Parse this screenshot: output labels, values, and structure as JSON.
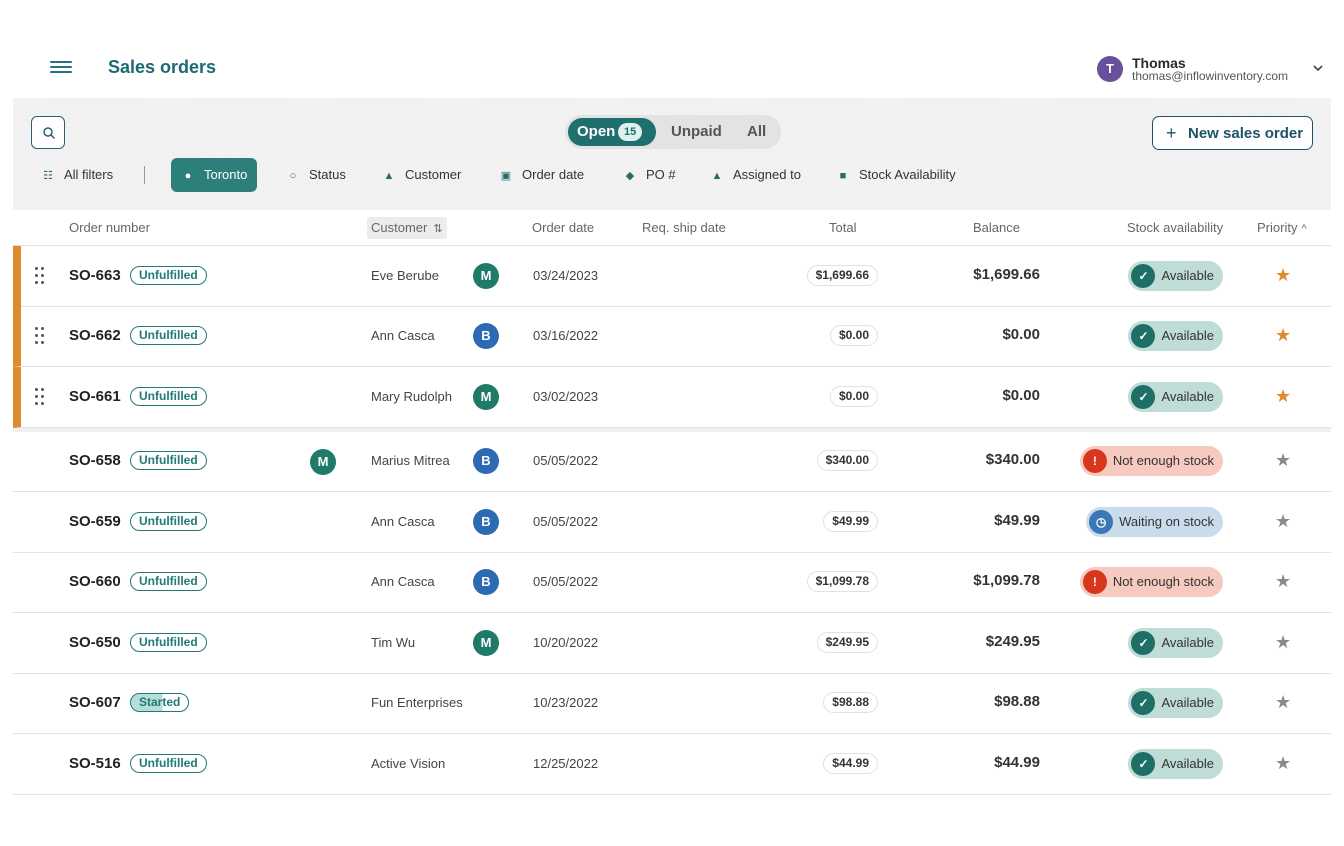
{
  "header": {
    "title": "Sales orders",
    "menu_icon": "hamburger-icon",
    "user": {
      "initial": "T",
      "name": "Thomas",
      "email": "thomas@inflowinventory.com",
      "avatar_color": "#6a4f9a"
    }
  },
  "toolbar": {
    "tabs": [
      {
        "label": "Open",
        "count": "15",
        "selected": true
      },
      {
        "label": "Unpaid",
        "selected": false
      },
      {
        "label": "All",
        "selected": false
      }
    ],
    "new_button": "New sales order",
    "filters": [
      {
        "label": "All filters",
        "icon": "sliders-icon"
      },
      {
        "label": "Toronto",
        "icon": "location-pin-icon",
        "active": true
      },
      {
        "label": "Status",
        "icon": "circle-icon"
      },
      {
        "label": "Customer",
        "icon": "person-icon"
      },
      {
        "label": "Order date",
        "icon": "calendar-icon"
      },
      {
        "label": "PO #",
        "icon": "po-icon"
      },
      {
        "label": "Assigned to",
        "icon": "person-icon"
      },
      {
        "label": "Stock Availability",
        "icon": "box-icon"
      }
    ]
  },
  "table": {
    "columns": {
      "order_number": "Order number",
      "customer": "Customer",
      "order_date": "Order date",
      "req_ship_date": "Req. ship date",
      "total": "Total",
      "balance": "Balance",
      "stock": "Stock availability",
      "priority": "Priority"
    },
    "rows": [
      {
        "order": "SO-663",
        "status": "Unfulfilled",
        "assignee": "",
        "customer": "Eve Berube",
        "customer_avatar": "M",
        "date": "03/24/2023",
        "total": "$1,699.66",
        "balance": "$1,699.66",
        "stock": "Available",
        "priority": true,
        "pinned": true
      },
      {
        "order": "SO-662",
        "status": "Unfulfilled",
        "assignee": "",
        "customer": "Ann Casca",
        "customer_avatar": "B",
        "date": "03/16/2022",
        "total": "$0.00",
        "balance": "$0.00",
        "stock": "Available",
        "priority": true,
        "pinned": true
      },
      {
        "order": "SO-661",
        "status": "Unfulfilled",
        "assignee": "",
        "customer": "Mary Rudolph",
        "customer_avatar": "M",
        "date": "03/02/2023",
        "total": "$0.00",
        "balance": "$0.00",
        "stock": "Available",
        "priority": true,
        "pinned": true
      },
      {
        "order": "SO-658",
        "status": "Unfulfilled",
        "assignee": "M",
        "customer": "Marius Mitrea",
        "customer_avatar": "B",
        "date": "05/05/2022",
        "total": "$340.00",
        "balance": "$340.00",
        "stock": "Not enough stock",
        "priority": false,
        "pinned": false
      },
      {
        "order": "SO-659",
        "status": "Unfulfilled",
        "assignee": "",
        "customer": "Ann Casca",
        "customer_avatar": "B",
        "date": "05/05/2022",
        "total": "$49.99",
        "balance": "$49.99",
        "stock": "Waiting on stock",
        "priority": false,
        "pinned": false
      },
      {
        "order": "SO-660",
        "status": "Unfulfilled",
        "assignee": "",
        "customer": "Ann Casca",
        "customer_avatar": "B",
        "date": "05/05/2022",
        "total": "$1,099.78",
        "balance": "$1,099.78",
        "stock": "Not enough stock",
        "priority": false,
        "pinned": false
      },
      {
        "order": "SO-650",
        "status": "Unfulfilled",
        "assignee": "",
        "customer": "Tim Wu",
        "customer_avatar": "M",
        "date": "10/20/2022",
        "total": "$249.95",
        "balance": "$249.95",
        "stock": "Available",
        "priority": false,
        "pinned": false
      },
      {
        "order": "SO-607",
        "status": "Started",
        "assignee": "",
        "customer": "Fun Enterprises",
        "customer_avatar": "",
        "date": "10/23/2022",
        "total": "$98.88",
        "balance": "$98.88",
        "stock": "Available",
        "priority": false,
        "pinned": false
      },
      {
        "order": "SO-516",
        "status": "Unfulfilled",
        "assignee": "",
        "customer": "Active Vision",
        "customer_avatar": "",
        "date": "12/25/2022",
        "total": "$44.99",
        "balance": "$44.99",
        "stock": "Available",
        "priority": false,
        "pinned": false
      }
    ]
  },
  "colors": {
    "brand": "#1f6f6f",
    "pinned_accent": "#e08a2e",
    "available_bg": "#bfdcd6",
    "not_enough_bg": "#f6c9c1",
    "waiting_bg": "#cadcec"
  }
}
